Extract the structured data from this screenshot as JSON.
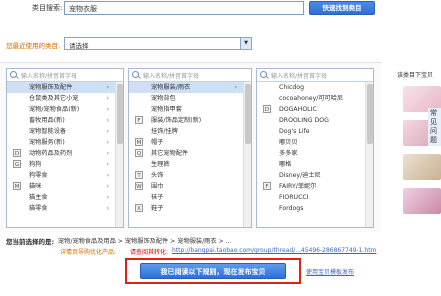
{
  "search": {
    "label": "类目搜索:",
    "value": "宠物衣服",
    "button": "快速找到类目"
  },
  "recent": {
    "label": "您最近使用的类目:",
    "placeholder": "请选择",
    "arrow_icon": "chevron-down-icon"
  },
  "columns": [
    {
      "filter_placeholder": "输入名称/拼音首字母",
      "items": [
        {
          "prefix": "",
          "label": "宠物服饰及配件",
          "selected": true,
          "has_children": true
        },
        {
          "prefix": "",
          "label": "仓鼠类及其它小宠",
          "selected": false,
          "has_children": true
        },
        {
          "prefix": "",
          "label": "宠物/宠物食品(新)",
          "selected": false,
          "has_children": true
        },
        {
          "prefix": "",
          "label": "畜牧用品(新)",
          "selected": false,
          "has_children": true
        },
        {
          "prefix": "",
          "label": "宠物智能设备",
          "selected": false,
          "has_children": true
        },
        {
          "prefix": "",
          "label": "宠物服务(新)",
          "selected": false,
          "has_children": true
        },
        {
          "prefix": "D",
          "label": "动物药品及药剂",
          "selected": false,
          "has_children": true
        },
        {
          "prefix": "G",
          "label": "狗狗",
          "selected": false,
          "has_children": true
        },
        {
          "prefix": "",
          "label": "狗零食",
          "selected": false,
          "has_children": true
        },
        {
          "prefix": "M",
          "label": "猫咪",
          "selected": false,
          "has_children": true
        },
        {
          "prefix": "",
          "label": "猫主食",
          "selected": false,
          "has_children": true
        },
        {
          "prefix": "",
          "label": "猫零食",
          "selected": false,
          "has_children": true
        }
      ]
    },
    {
      "filter_placeholder": "输入名称/拼音首字母",
      "items": [
        {
          "prefix": "",
          "label": "宠物服装/雨衣",
          "selected": true,
          "has_children": true
        },
        {
          "prefix": "",
          "label": "宠物背包",
          "selected": false,
          "has_children": false
        },
        {
          "prefix": "",
          "label": "宠物指甲套",
          "selected": false,
          "has_children": false
        },
        {
          "prefix": "F",
          "label": "服装/饰品定制(新)",
          "selected": false,
          "has_children": false
        },
        {
          "prefix": "",
          "label": "挂饰/挂牌",
          "selected": false,
          "has_children": false
        },
        {
          "prefix": "M",
          "label": "帽子",
          "selected": false,
          "has_children": false
        },
        {
          "prefix": "Q",
          "label": "其它宠物配件",
          "selected": false,
          "has_children": false
        },
        {
          "prefix": "",
          "label": "生理裤",
          "selected": false,
          "has_children": false
        },
        {
          "prefix": "T",
          "label": "头饰",
          "selected": false,
          "has_children": false
        },
        {
          "prefix": "W",
          "label": "围巾",
          "selected": false,
          "has_children": false
        },
        {
          "prefix": "",
          "label": "袜子",
          "selected": false,
          "has_children": false
        },
        {
          "prefix": "X",
          "label": "鞋子",
          "selected": false,
          "has_children": false
        }
      ]
    },
    {
      "filter_placeholder": "输入名称/拼音首字母",
      "items": [
        {
          "prefix": "",
          "label": "Chicdog",
          "selected": false,
          "has_children": false
        },
        {
          "prefix": "",
          "label": "cocoahoney/可可哈尼",
          "selected": false,
          "has_children": false
        },
        {
          "prefix": "D",
          "label": "DOGAHOLIC",
          "selected": false,
          "has_children": false
        },
        {
          "prefix": "",
          "label": "DROOLING DOG",
          "selected": false,
          "has_children": false
        },
        {
          "prefix": "",
          "label": "Dog's Life",
          "selected": false,
          "has_children": false
        },
        {
          "prefix": "",
          "label": "嘟贝贝",
          "selected": false,
          "has_children": false
        },
        {
          "prefix": "",
          "label": "多多家",
          "selected": false,
          "has_children": false
        },
        {
          "prefix": "",
          "label": "嘟格",
          "selected": false,
          "has_children": false
        },
        {
          "prefix": "",
          "label": "Disney/迪士尼",
          "selected": false,
          "has_children": false
        },
        {
          "prefix": "F",
          "label": "FAIRY/菲妮尔",
          "selected": false,
          "has_children": false
        },
        {
          "prefix": "",
          "label": "FIORUCCI",
          "selected": false,
          "has_children": false
        },
        {
          "prefix": "",
          "label": "Fordogs",
          "selected": false,
          "has_children": false
        }
      ]
    }
  ],
  "right_panel": {
    "title": "该类目下宝贝",
    "promo_text": "常见问题"
  },
  "selected": {
    "label": "您当前选择的是:",
    "path": "宠物/宠物食品及用品 > 宠物服饰及配件 > 宠物服装/雨衣 > ..."
  },
  "notice": {
    "text1": "详情页导购优化产品:",
    "text2": "请查阅其转化:",
    "link": "http://bangpai.taobao.com/group/thread/...45496-286867749-1.htm"
  },
  "publish": {
    "button": "我已阅读以下规则，现在发布宝贝",
    "legacy_link": "使用宝贝模板发布"
  },
  "colors": {
    "accent": "#2e6fd7",
    "warning": "#d26a00",
    "highlight_frame": "#e0221b",
    "selected_row": "#cfe0f6"
  }
}
